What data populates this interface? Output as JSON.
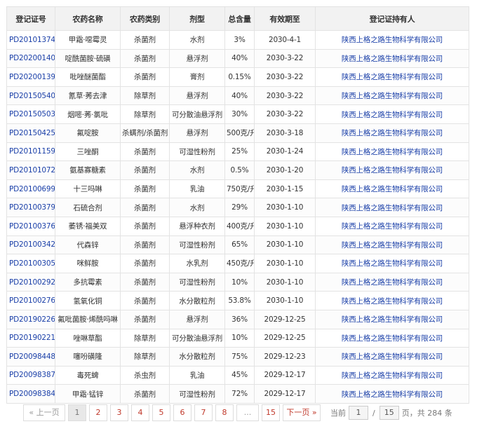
{
  "table": {
    "headers": [
      "登记证号",
      "农药名称",
      "农药类别",
      "剂型",
      "总含量",
      "有效期至",
      "登记证持有人"
    ],
    "rows": [
      [
        "PD20101374",
        "甲霜·噁霉灵",
        "杀菌剂",
        "水剂",
        "3%",
        "2030-4-1",
        "陕西上格之路生物科学有限公司"
      ],
      [
        "PD20200140",
        "啶酰菌胺·硫磺",
        "杀菌剂",
        "悬浮剂",
        "40%",
        "2030-3-22",
        "陕西上格之路生物科学有限公司"
      ],
      [
        "PD20200139",
        "吡唑醚菌酯",
        "杀菌剂",
        "膏剂",
        "0.15%",
        "2030-3-22",
        "陕西上格之路生物科学有限公司"
      ],
      [
        "PD20150540",
        "氰草·莠去津",
        "除草剂",
        "悬浮剂",
        "40%",
        "2030-3-22",
        "陕西上格之路生物科学有限公司"
      ],
      [
        "PD20150503",
        "烟嘧·莠·氯吡",
        "除草剂",
        "可分散油悬浮剂",
        "30%",
        "2030-3-22",
        "陕西上格之路生物科学有限公司"
      ],
      [
        "PD20150425",
        "氟啶胺",
        "杀螨剂/杀菌剂",
        "悬浮剂",
        "500克/升",
        "2030-3-18",
        "陕西上格之路生物科学有限公司"
      ],
      [
        "PD20101159",
        "三唑酮",
        "杀菌剂",
        "可湿性粉剂",
        "25%",
        "2030-1-24",
        "陕西上格之路生物科学有限公司"
      ],
      [
        "PD20101072",
        "氨基寡糖素",
        "杀菌剂",
        "水剂",
        "0.5%",
        "2030-1-20",
        "陕西上格之路生物科学有限公司"
      ],
      [
        "PD20100699",
        "十三吗啉",
        "杀菌剂",
        "乳油",
        "750克/升",
        "2030-1-15",
        "陕西上格之路生物科学有限公司"
      ],
      [
        "PD20100379",
        "石硫合剂",
        "杀菌剂",
        "水剂",
        "29%",
        "2030-1-10",
        "陕西上格之路生物科学有限公司"
      ],
      [
        "PD20100376",
        "萎锈·福美双",
        "杀菌剂",
        "悬浮种衣剂",
        "400克/升",
        "2030-1-10",
        "陕西上格之路生物科学有限公司"
      ],
      [
        "PD20100342",
        "代森锌",
        "杀菌剂",
        "可湿性粉剂",
        "65%",
        "2030-1-10",
        "陕西上格之路生物科学有限公司"
      ],
      [
        "PD20100305",
        "咪鲜胺",
        "杀菌剂",
        "水乳剂",
        "450克/升",
        "2030-1-10",
        "陕西上格之路生物科学有限公司"
      ],
      [
        "PD20100292",
        "多抗霉素",
        "杀菌剂",
        "可湿性粉剂",
        "10%",
        "2030-1-10",
        "陕西上格之路生物科学有限公司"
      ],
      [
        "PD20100276",
        "氢氧化铜",
        "杀菌剂",
        "水分散粒剂",
        "53.8%",
        "2030-1-10",
        "陕西上格之路生物科学有限公司"
      ],
      [
        "PD20190226",
        "氟吡菌胺·烯酰吗啉",
        "杀菌剂",
        "悬浮剂",
        "36%",
        "2029-12-25",
        "陕西上格之路生物科学有限公司"
      ],
      [
        "PD20190221",
        "唑啉草酯",
        "除草剂",
        "可分散油悬浮剂",
        "10%",
        "2029-12-25",
        "陕西上格之路生物科学有限公司"
      ],
      [
        "PD20098448",
        "噻吩磺隆",
        "除草剂",
        "水分散粒剂",
        "75%",
        "2029-12-23",
        "陕西上格之路生物科学有限公司"
      ],
      [
        "PD20098387",
        "毒死蜱",
        "杀虫剂",
        "乳油",
        "45%",
        "2029-12-17",
        "陕西上格之路生物科学有限公司"
      ],
      [
        "PD20098384",
        "甲霜·锰锌",
        "杀菌剂",
        "可湿性粉剂",
        "72%",
        "2029-12-17",
        "陕西上格之路生物科学有限公司"
      ]
    ]
  },
  "pagination": {
    "prev_label": "« 上一页",
    "pages": [
      "1",
      "2",
      "3",
      "4",
      "5",
      "6",
      "7",
      "8"
    ],
    "current_page": "1",
    "ellipsis": "...",
    "last_page": "15",
    "next_label": "下一页 »",
    "jump_prefix": "当前",
    "jump_current": "1",
    "jump_sep": "/",
    "jump_total": "15",
    "jump_suffix": "页，共 284 条"
  }
}
